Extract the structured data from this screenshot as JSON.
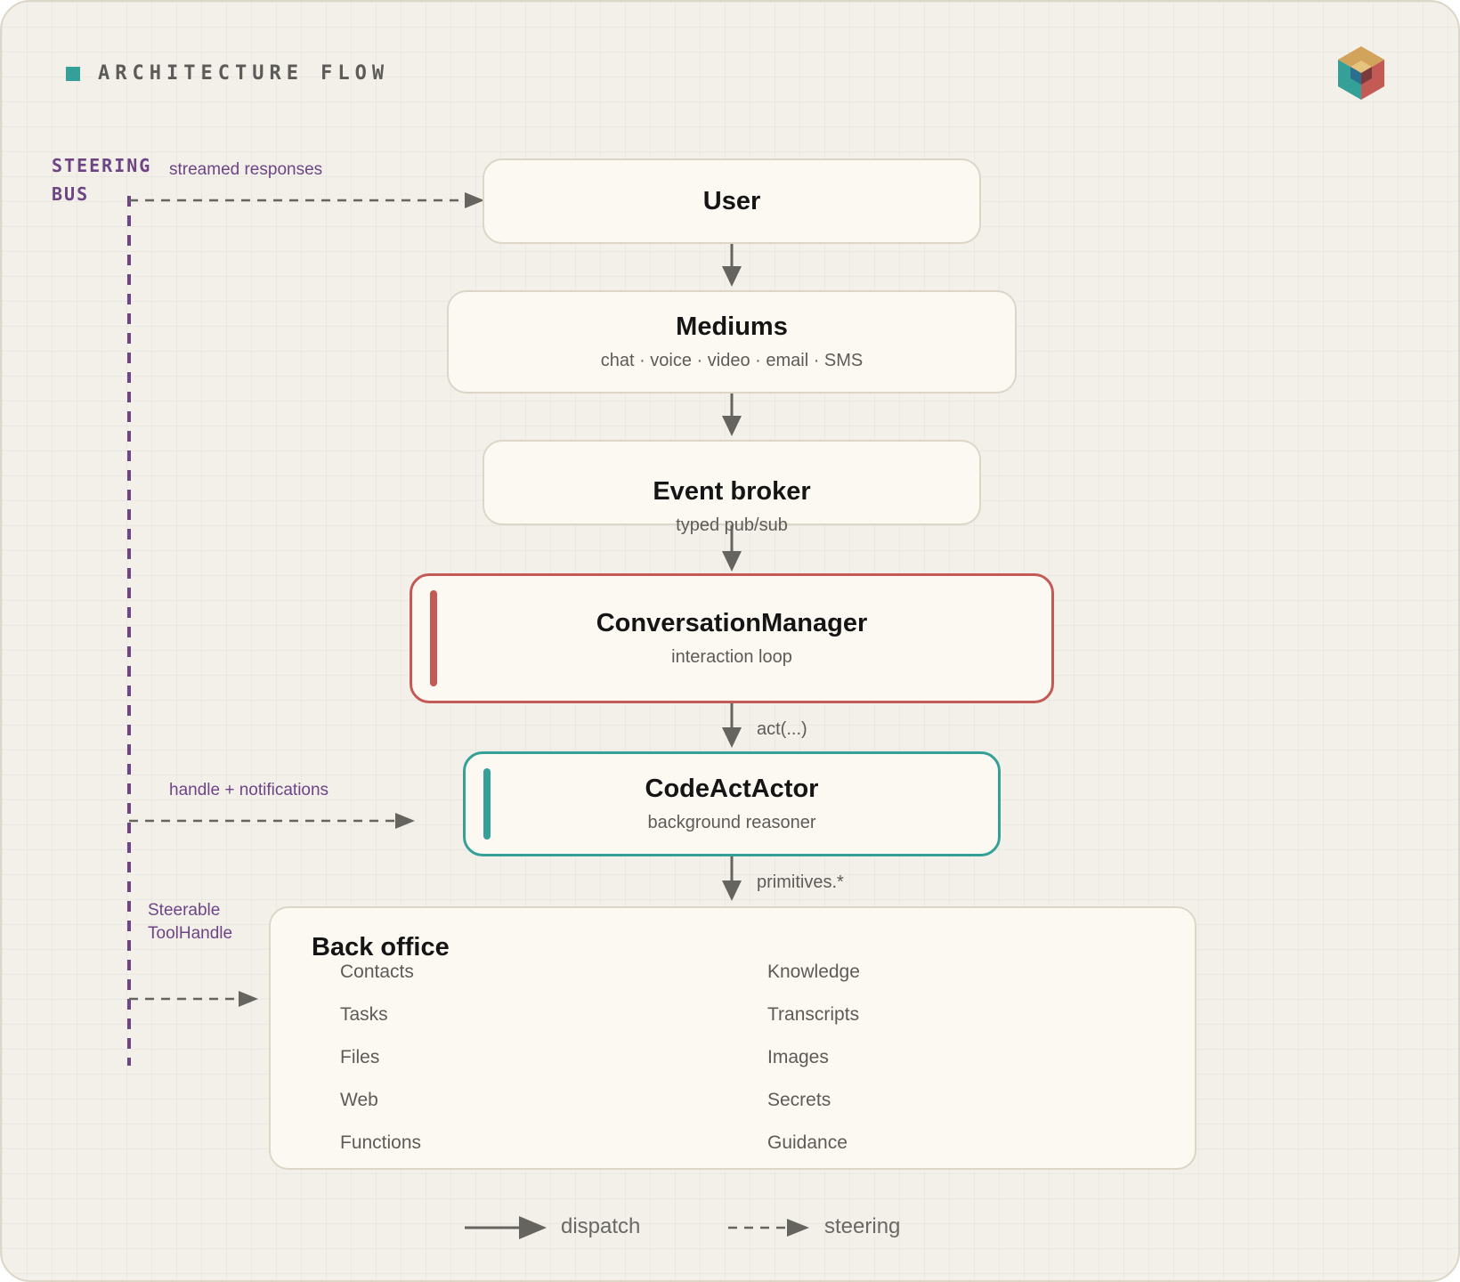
{
  "header": {
    "title": "ARCHITECTURE FLOW"
  },
  "steering_bus": {
    "label_line1": "STEERING",
    "label_line2": "BUS"
  },
  "steering_labels": {
    "streamed": "streamed responses",
    "handle": "handle + notifications",
    "steerable_line1": "Steerable",
    "steerable_line2": "ToolHandle"
  },
  "nodes": {
    "user": {
      "title": "User"
    },
    "mediums": {
      "title": "Mediums",
      "subtitle": "chat · voice · video · email · SMS"
    },
    "event_broker": {
      "title": "Event broker",
      "subtitle": "typed pub/sub"
    },
    "conversation_manager": {
      "title": "ConversationManager",
      "subtitle": "interaction loop"
    },
    "code_act_actor": {
      "title": "CodeActActor",
      "subtitle": "background reasoner"
    }
  },
  "edges": {
    "act": "act(...)",
    "primitives": "primitives.*"
  },
  "back_office": {
    "title": "Back office",
    "left": [
      "Contacts",
      "Tasks",
      "Files",
      "Web",
      "Functions"
    ],
    "right": [
      "Knowledge",
      "Transcripts",
      "Images",
      "Secrets",
      "Guidance"
    ]
  },
  "legend": {
    "dispatch": "dispatch",
    "steering": "steering"
  },
  "colors": {
    "accent_red": "#c45a55",
    "accent_teal": "#35a098",
    "steering_purple": "#6d4585",
    "arrow_gray": "#66645f"
  }
}
